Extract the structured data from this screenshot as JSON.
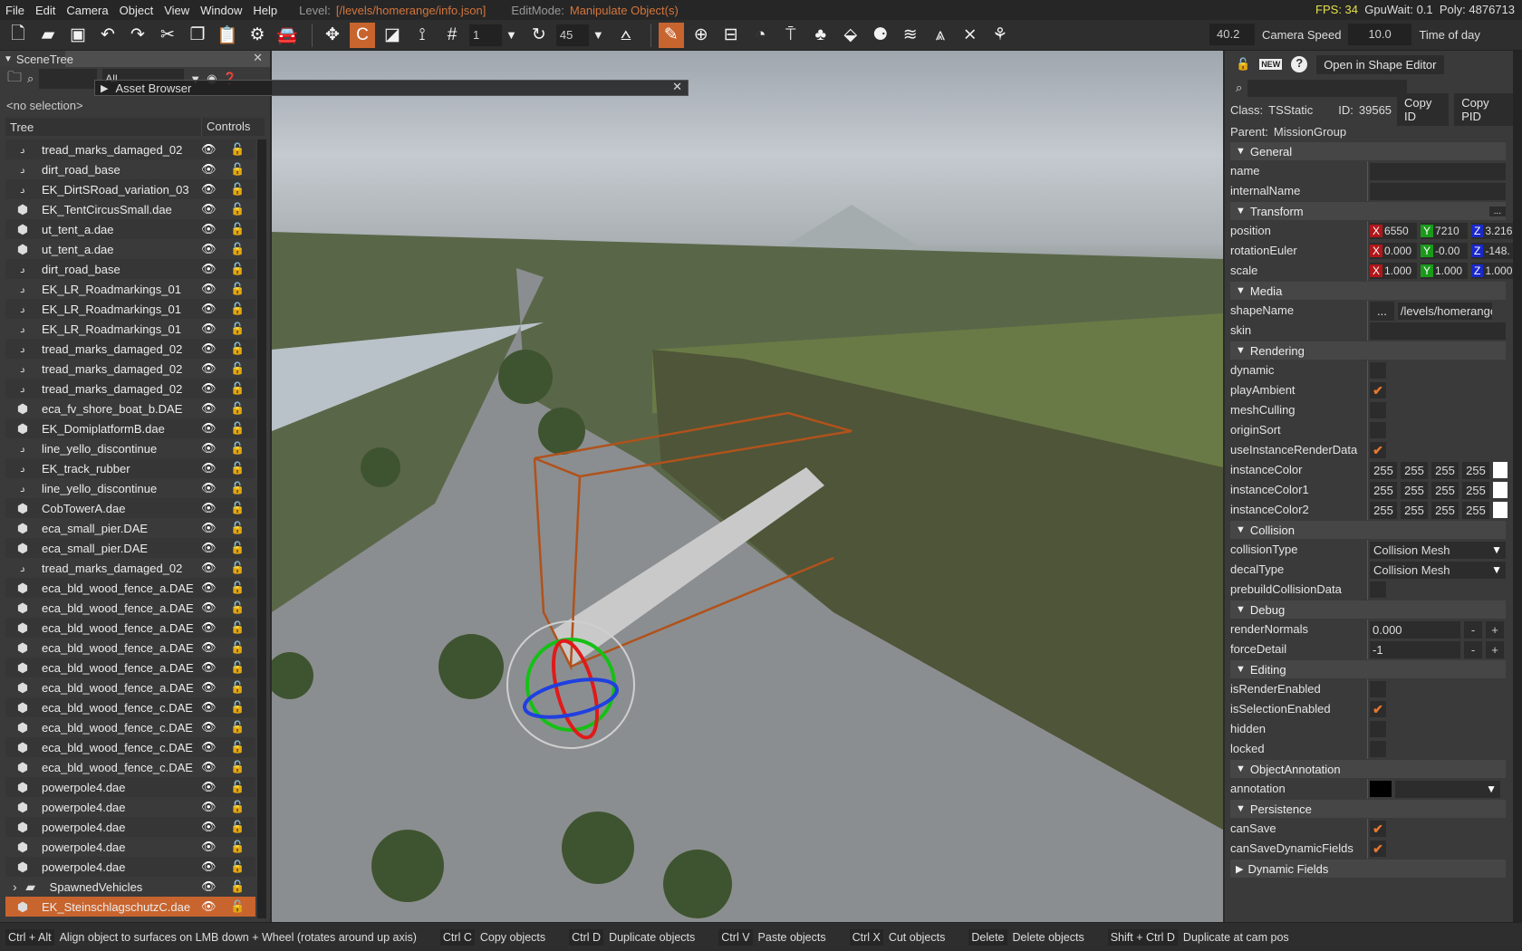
{
  "menu": {
    "items": [
      "File",
      "Edit",
      "Camera",
      "Object",
      "View",
      "Window",
      "Help"
    ],
    "level_label": "Level:",
    "level_value": "[/levels/homerange/info.json]",
    "editmode_label": "EditMode:",
    "editmode_value": "Manipulate Object(s)"
  },
  "stats": {
    "fps": "FPS: 34",
    "gpuwait": "GpuWait: 0.1",
    "poly": "Poly: 4876713"
  },
  "toolbar": {
    "grid_value": "1",
    "rotate_snap_value": "45",
    "camera_speed_value": "40.2",
    "camera_speed_label": "Camera Speed",
    "time_of_day_value": "10.0",
    "time_of_day_label": "Time of day"
  },
  "scenetree": {
    "title": "SceneTree",
    "filter_value": "All",
    "no_selection": "<no selection>",
    "col_tree": "Tree",
    "col_controls": "Controls",
    "items": [
      {
        "name": "tread_marks_damaged_02",
        "type": "road"
      },
      {
        "name": "dirt_road_base",
        "type": "road"
      },
      {
        "name": "EK_DirtSRoad_variation_03",
        "type": "road"
      },
      {
        "name": "EK_TentCircusSmall.dae",
        "type": "mesh"
      },
      {
        "name": "ut_tent_a.dae",
        "type": "mesh"
      },
      {
        "name": "ut_tent_a.dae",
        "type": "mesh"
      },
      {
        "name": "dirt_road_base",
        "type": "road"
      },
      {
        "name": "EK_LR_Roadmarkings_01",
        "type": "road"
      },
      {
        "name": "EK_LR_Roadmarkings_01",
        "type": "road"
      },
      {
        "name": "EK_LR_Roadmarkings_01",
        "type": "road"
      },
      {
        "name": "tread_marks_damaged_02",
        "type": "road"
      },
      {
        "name": "tread_marks_damaged_02",
        "type": "road"
      },
      {
        "name": "tread_marks_damaged_02",
        "type": "road"
      },
      {
        "name": "eca_fv_shore_boat_b.DAE",
        "type": "mesh"
      },
      {
        "name": "EK_DomiplatformB.dae",
        "type": "mesh"
      },
      {
        "name": "line_yello_discontinue",
        "type": "road"
      },
      {
        "name": "EK_track_rubber",
        "type": "road"
      },
      {
        "name": "line_yello_discontinue",
        "type": "road"
      },
      {
        "name": "CobTowerA.dae",
        "type": "mesh"
      },
      {
        "name": "eca_small_pier.DAE",
        "type": "mesh"
      },
      {
        "name": "eca_small_pier.DAE",
        "type": "mesh"
      },
      {
        "name": "tread_marks_damaged_02",
        "type": "road"
      },
      {
        "name": "eca_bld_wood_fence_a.DAE",
        "type": "mesh"
      },
      {
        "name": "eca_bld_wood_fence_a.DAE",
        "type": "mesh"
      },
      {
        "name": "eca_bld_wood_fence_a.DAE",
        "type": "mesh"
      },
      {
        "name": "eca_bld_wood_fence_a.DAE",
        "type": "mesh"
      },
      {
        "name": "eca_bld_wood_fence_a.DAE",
        "type": "mesh"
      },
      {
        "name": "eca_bld_wood_fence_a.DAE",
        "type": "mesh"
      },
      {
        "name": "eca_bld_wood_fence_c.DAE",
        "type": "mesh"
      },
      {
        "name": "eca_bld_wood_fence_c.DAE",
        "type": "mesh"
      },
      {
        "name": "eca_bld_wood_fence_c.DAE",
        "type": "mesh"
      },
      {
        "name": "eca_bld_wood_fence_c.DAE",
        "type": "mesh"
      },
      {
        "name": "powerpole4.dae",
        "type": "mesh"
      },
      {
        "name": "powerpole4.dae",
        "type": "mesh"
      },
      {
        "name": "powerpole4.dae",
        "type": "mesh"
      },
      {
        "name": "powerpole4.dae",
        "type": "mesh"
      },
      {
        "name": "powerpole4.dae",
        "type": "mesh"
      },
      {
        "name": "SpawnedVehicles",
        "type": "folder"
      },
      {
        "name": "EK_SteinschlagschutzC.dae",
        "type": "mesh",
        "selected": true
      }
    ]
  },
  "asset_browser": {
    "title": "Asset Browser"
  },
  "inspector": {
    "open_shape_editor": "Open in Shape Editor",
    "new_badge": "NEW",
    "class_label": "Class:",
    "class_value": "TSStatic",
    "id_label": "ID:",
    "id_value": "39565",
    "copy_id": "Copy ID",
    "copy_pid": "Copy PID",
    "parent_label": "Parent:",
    "parent_value": "MissionGroup",
    "sections": {
      "general": "General",
      "transform": "Transform",
      "media": "Media",
      "rendering": "Rendering",
      "collision": "Collision",
      "debug": "Debug",
      "editing": "Editing",
      "annotation": "ObjectAnnotation",
      "persistence": "Persistence",
      "dynamic": "Dynamic Fields"
    },
    "fields": {
      "name": "name",
      "internalName": "internalName",
      "position": "position",
      "rotationEuler": "rotationEuler",
      "scale": "scale",
      "shapeName": "shapeName",
      "skin": "skin",
      "dynamic": "dynamic",
      "playAmbient": "playAmbient",
      "meshCulling": "meshCulling",
      "originSort": "originSort",
      "useInstanceRenderData": "useInstanceRenderData",
      "instanceColor": "instanceColor",
      "instanceColor1": "instanceColor1",
      "instanceColor2": "instanceColor2",
      "collisionType": "collisionType",
      "decalType": "decalType",
      "prebuildCollisionData": "prebuildCollisionData",
      "renderNormals": "renderNormals",
      "forceDetail": "forceDetail",
      "isRenderEnabled": "isRenderEnabled",
      "isSelectionEnabled": "isSelectionEnabled",
      "hidden": "hidden",
      "locked": "locked",
      "annotation": "annotation",
      "canSave": "canSave",
      "canSaveDynamicFields": "canSaveDynamicFields"
    },
    "values": {
      "position": [
        "6550",
        "7210",
        "3.216"
      ],
      "rotationEuler": [
        "0.000",
        "-0.00",
        "-148."
      ],
      "scale": [
        "1.000",
        "1.000",
        "1.000"
      ],
      "transform_more": "...",
      "shape_browse": "...",
      "shapeName": "/levels/homerange",
      "color": [
        "255",
        "255",
        "255",
        "255"
      ],
      "collisionType": "Collision Mesh",
      "decalType": "Collision Mesh",
      "renderNormals": "0.000",
      "forceDetail": "-1",
      "minus": "-",
      "plus": "+"
    },
    "axis": {
      "x": "X",
      "y": "Y",
      "z": "Z"
    }
  },
  "status": [
    {
      "key": "Ctrl + Alt",
      "desc": "Align object to surfaces on LMB down + Wheel (rotates around up axis)"
    },
    {
      "key": "Ctrl C",
      "desc": "Copy objects"
    },
    {
      "key": "Ctrl D",
      "desc": "Duplicate objects"
    },
    {
      "key": "Ctrl V",
      "desc": "Paste objects"
    },
    {
      "key": "Ctrl X",
      "desc": "Cut objects"
    },
    {
      "key": "Delete",
      "desc": "Delete objects"
    },
    {
      "key": "Shift + Ctrl D",
      "desc": "Duplicate at cam pos"
    }
  ],
  "colors": {
    "accent": "#c8642e",
    "fps": "#e3e04a",
    "axis_x": "#b0171a",
    "axis_y": "#1a9a1a",
    "axis_z": "#1a28c8"
  }
}
